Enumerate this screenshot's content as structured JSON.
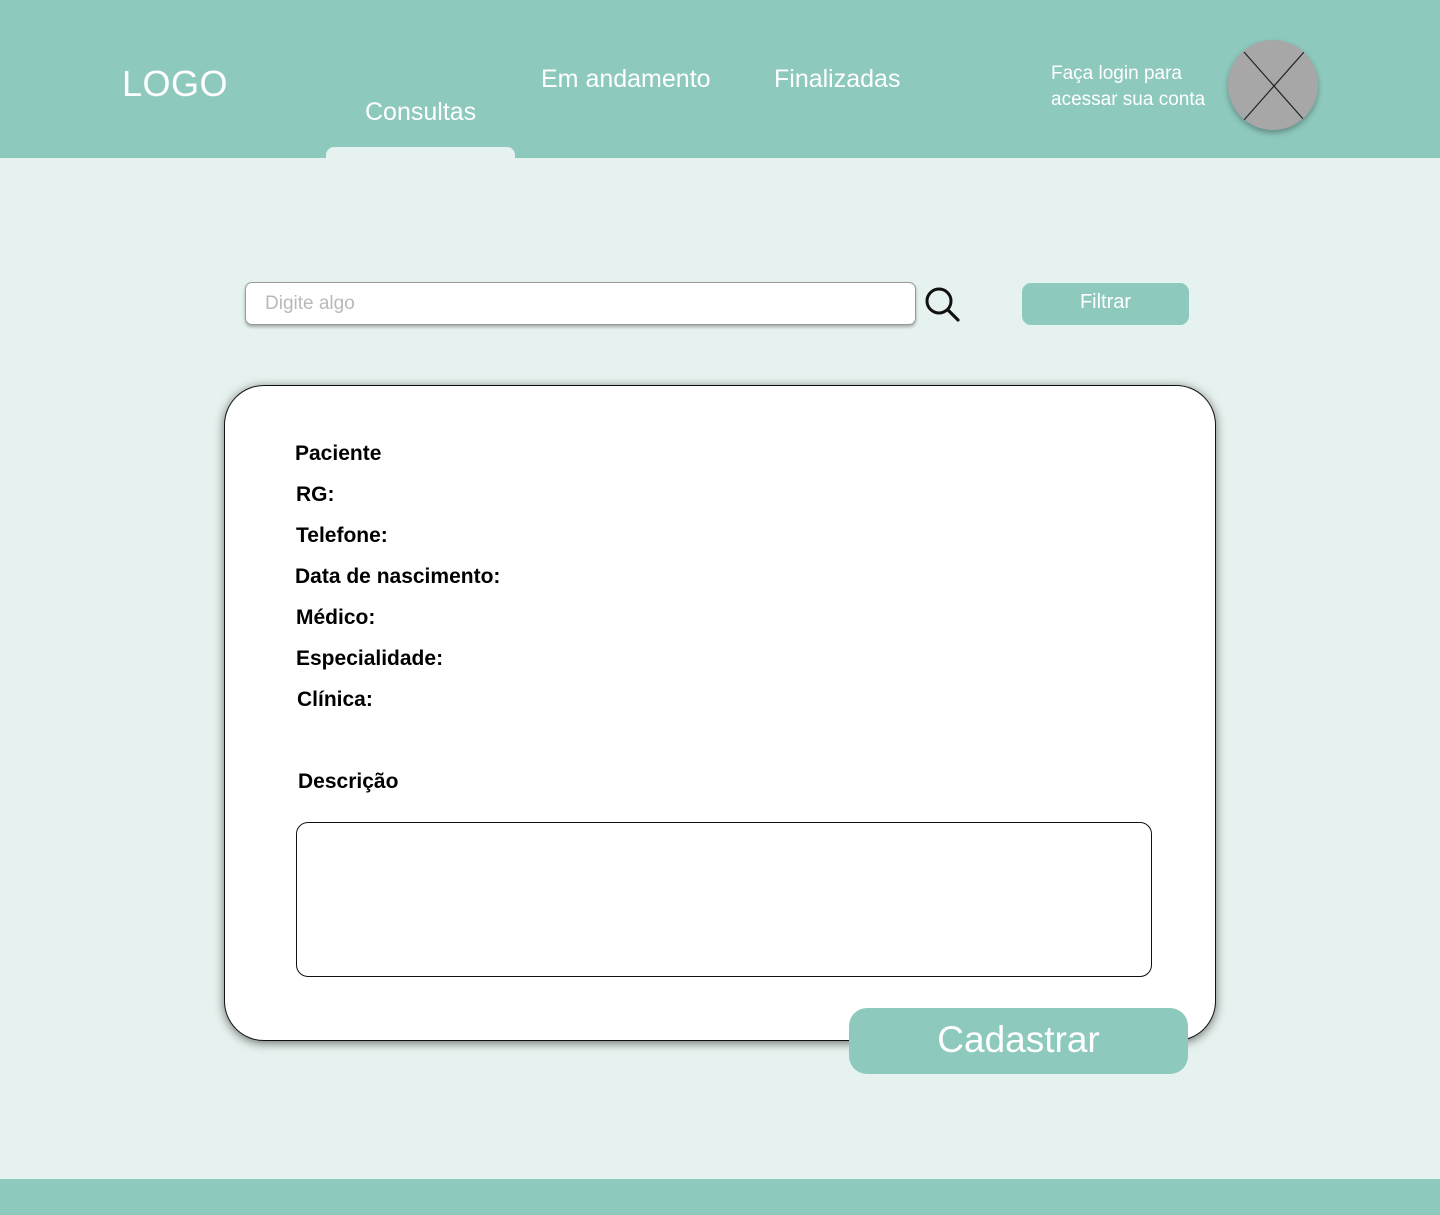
{
  "header": {
    "logo": "LOGO",
    "nav": {
      "consultas": "Consultas",
      "em_andamento": "Em andamento",
      "finalizadas": "Finalizadas"
    },
    "active_tab": "Consultas",
    "login_prompt": {
      "line1": "Faça login para",
      "line2": "acessar sua conta"
    },
    "avatar_icon": "avatar-placeholder-icon"
  },
  "search": {
    "value": "",
    "placeholder": "Digite algo",
    "icon": "search-icon"
  },
  "filter_button": {
    "label": "Filtrar"
  },
  "form": {
    "fields": {
      "paciente": "Paciente",
      "rg": "RG:",
      "telefone": "Telefone:",
      "data_nascimento": "Data de nascimento:",
      "medico": "Médico:",
      "especialidade": "Especialidade:",
      "clinica": "Clínica:"
    },
    "description_label": "Descrição",
    "description_value": "",
    "submit_label": "Cadastrar"
  },
  "colors": {
    "primary": "#8ec9be",
    "background": "#e6f2ef",
    "card": "#ffffff",
    "avatar": "#a7a7a7"
  }
}
